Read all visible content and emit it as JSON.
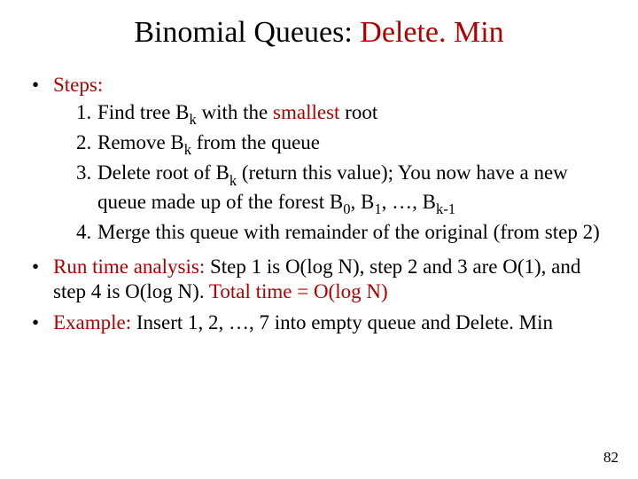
{
  "title_a": "Binomial Queues: ",
  "title_b": "Delete. Min",
  "steps_label": "Steps:",
  "steps": {
    "n1": "1.",
    "n2": "2.",
    "n3": "3.",
    "n4": "4.",
    "s1_a": "Find tree B",
    "s1_k": "k",
    "s1_b": " with the ",
    "s1_red": "smallest",
    "s1_c": " root",
    "s2_a": "Remove B",
    "s2_k": "k",
    "s2_b": " from the queue",
    "s3_a": "Delete root of B",
    "s3_k": "k",
    "s3_b": " (return this value); You now have a new queue made up of the forest B",
    "s3_z": "0",
    "s3_c": ", B",
    "s3_o": "1",
    "s3_d": ", …, B",
    "s3_km1": "k-1",
    "s4": "Merge this queue with remainder of the original (from step 2)"
  },
  "runtime_label": "Run time analysis:",
  "runtime_rest": " Step 1 is O(log N), step 2 and 3 are O(1), and step 4 is O(log N). ",
  "runtime_total": "Total time = O(log N)",
  "example_label": "Example:",
  "example_rest_a": " Insert 1, 2, …, 7 into empty queue and ",
  "example_rest_b": "Delete. Min",
  "page_number": "82"
}
